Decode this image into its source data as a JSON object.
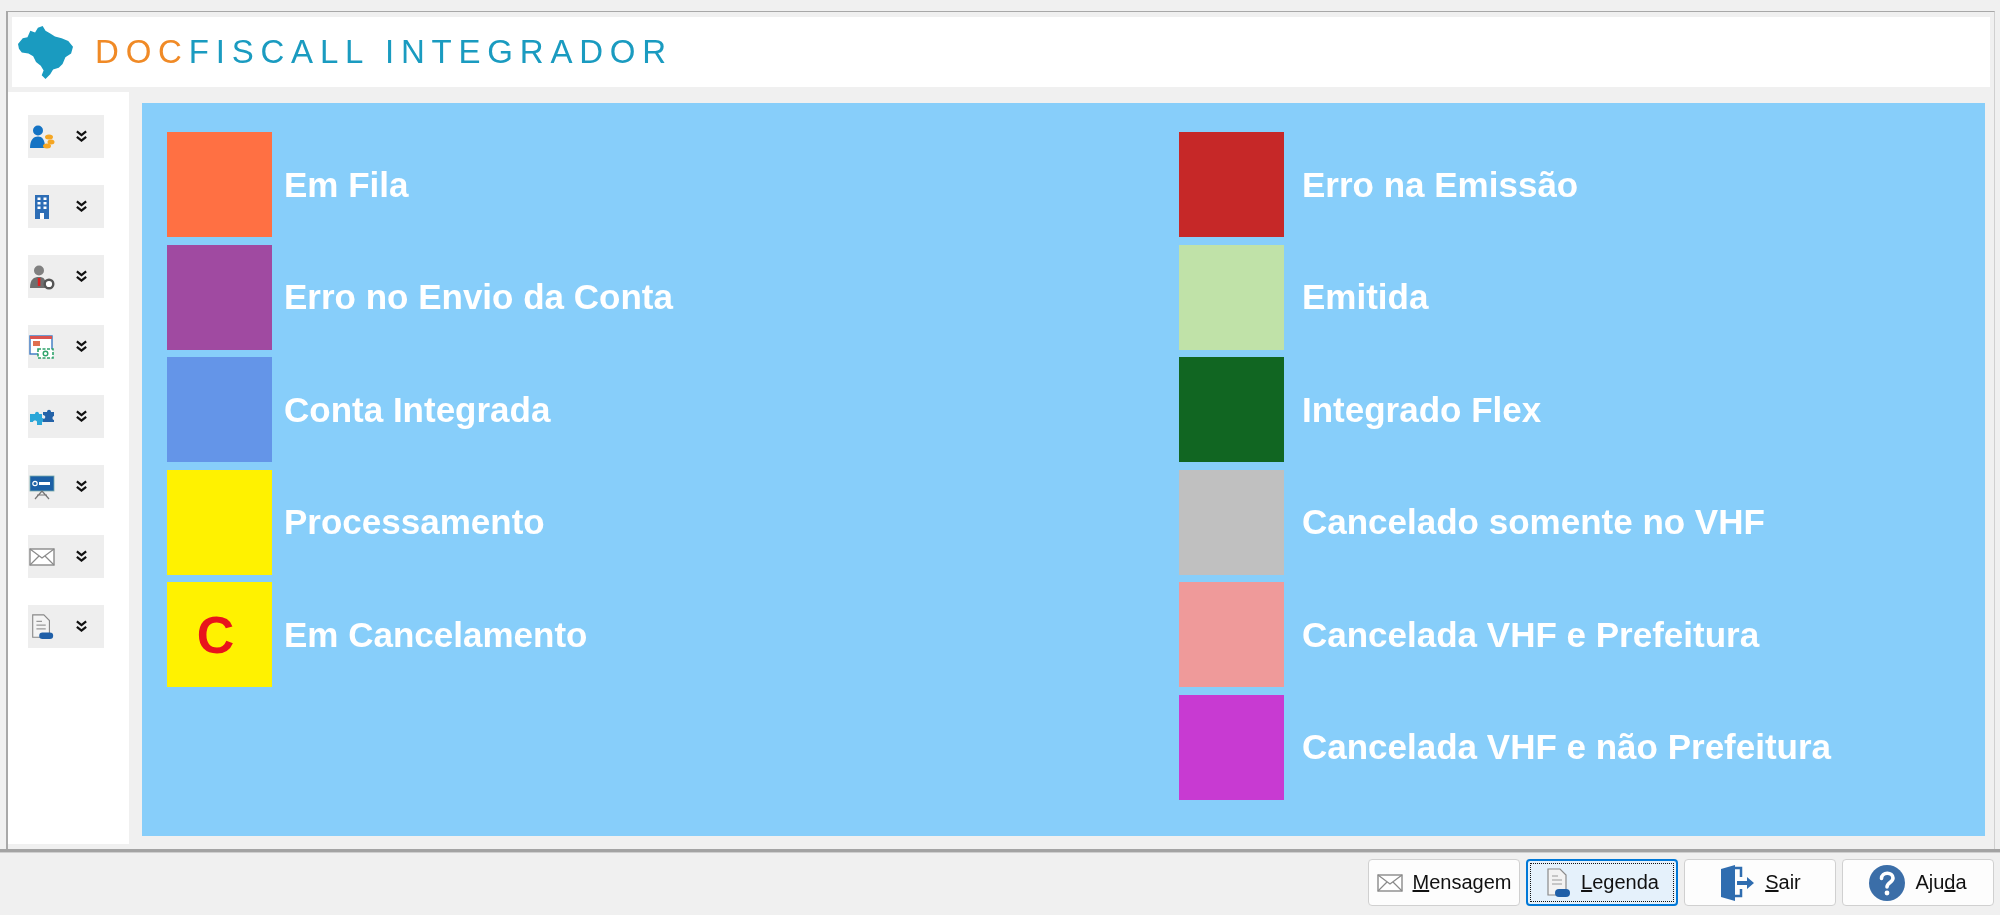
{
  "header": {
    "title_accent": "DOC",
    "title_main": "FISCALL INTEGRADOR"
  },
  "legend_columns": [
    {
      "items": [
        {
          "label": "Em Fila",
          "color": "#ff7043"
        },
        {
          "label": "Erro no Envio da Conta",
          "color": "#a04aa1"
        },
        {
          "label": "Conta Integrada",
          "color": "#6495e8"
        },
        {
          "label": "Processamento",
          "color": "#fff200"
        },
        {
          "label": "Em Cancelamento",
          "color": "#fff200",
          "mark": "C"
        }
      ]
    },
    {
      "items": [
        {
          "label": "Erro na Emissão",
          "color": "#c62828"
        },
        {
          "label": "Emitida",
          "color": "#c0e2a8"
        },
        {
          "label": "Integrado Flex",
          "color": "#116622"
        },
        {
          "label": "Cancelado somente no VHF",
          "color": "#c0c0c0"
        },
        {
          "label": "Cancelada VHF e Prefeitura",
          "color": "#ef9a9a"
        },
        {
          "label": "Cancelada VHF e não Prefeitura",
          "color": "#c83ad2"
        }
      ]
    }
  ],
  "buttons": [
    {
      "access_key": "M",
      "label_after": "ensagem",
      "focused": false
    },
    {
      "access_key": "L",
      "label_after": "egenda",
      "focused": true
    },
    {
      "access_key": "S",
      "label_after": "air",
      "focused": false
    },
    {
      "label_before": "Aju",
      "access_key": "d",
      "label_after": "a",
      "focused": false
    }
  ]
}
